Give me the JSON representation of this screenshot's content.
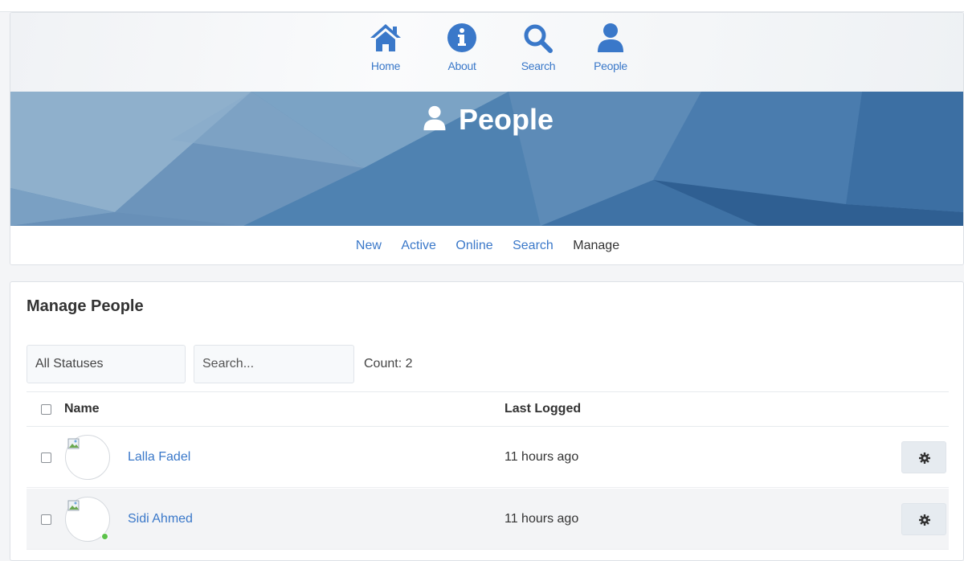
{
  "top_nav": {
    "items": [
      {
        "label": "Home",
        "icon": "home-icon"
      },
      {
        "label": "About",
        "icon": "info-icon"
      },
      {
        "label": "Search",
        "icon": "search-icon"
      },
      {
        "label": "People",
        "icon": "user-icon"
      }
    ]
  },
  "hero": {
    "title": "People",
    "icon": "user-icon"
  },
  "sub_nav": {
    "items": [
      "New",
      "Active",
      "Online",
      "Search",
      "Manage"
    ],
    "active": "Manage"
  },
  "manage": {
    "title": "Manage People",
    "status_filter": "All Statuses",
    "search_placeholder": "Search...",
    "count": "Count: 2",
    "columns": {
      "name": "Name",
      "last_logged": "Last Logged"
    },
    "rows": [
      {
        "name": "Lalla Fadel",
        "last_logged": "11 hours ago",
        "online": false
      },
      {
        "name": "Sidi Ahmed",
        "last_logged": "11 hours ago",
        "online": true
      }
    ]
  },
  "colors": {
    "link": "#3a78c9",
    "hero_blue": "#4f80b2",
    "online": "#5cc24a"
  }
}
